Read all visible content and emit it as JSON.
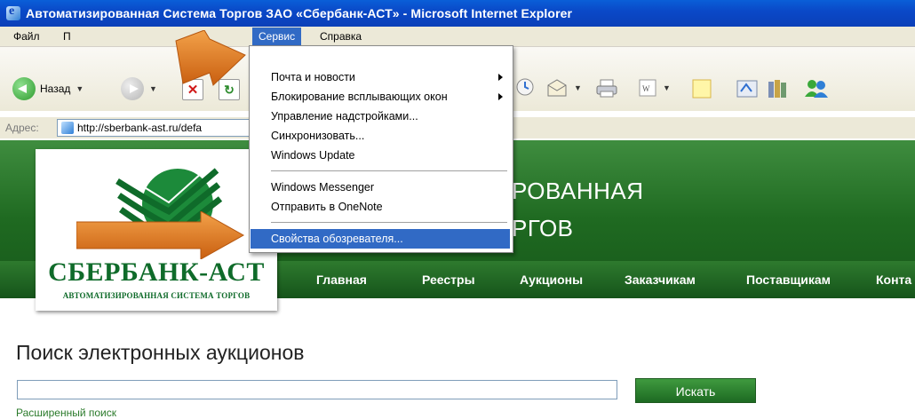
{
  "window": {
    "title": "Автоматизированная Система Торгов ЗАО «Сбербанк-АСТ» - Microsoft Internet Explorer"
  },
  "menubar": {
    "items": [
      "Файл",
      "П",
      "Сервис",
      "Справка"
    ]
  },
  "toolbar": {
    "back_label": "Назад"
  },
  "address": {
    "label": "Адрес:",
    "url": "http://sberbank-ast.ru/defa"
  },
  "dropdown": {
    "items": [
      "Почта и новости",
      "Блокирование всплывающих окон",
      "Управление надстройками...",
      "Синхронизовать...",
      "Windows Update",
      "Windows Messenger",
      "Отправить в OneNote",
      "Свойства обозревателя..."
    ]
  },
  "site": {
    "header_line1": "РОВАННАЯ",
    "header_line2": "РГОВ",
    "logo_name": "СБЕРБАНК-АСТ",
    "logo_subtitle": "АВТОМАТИЗИРОВАННАЯ СИСТЕМА ТОРГОВ",
    "nav": [
      "Главная",
      "Реестры",
      "Аукционы",
      "Заказчикам",
      "Поставщикам",
      "Конта"
    ]
  },
  "search": {
    "title": "Поиск электронных аукционов",
    "input_value": "",
    "button": "Искать",
    "advanced_link": "Расширенный поиск"
  },
  "colors": {
    "accent_green": "#1f6a21",
    "menu_highlight": "#316ac5",
    "arrow_orange": "#e07a1f"
  }
}
